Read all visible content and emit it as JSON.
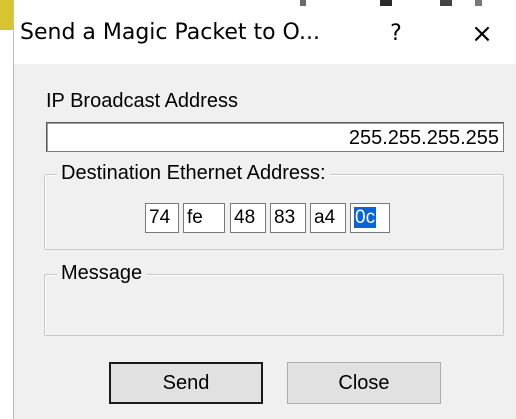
{
  "window": {
    "title": "Send a Magic Packet to O...",
    "help_label": "?",
    "close_label": "×"
  },
  "ip_broadcast": {
    "label": "IP Broadcast Address",
    "value": "255.255.255.255"
  },
  "destination": {
    "legend": "Destination Ethernet Address:",
    "octets": [
      "74",
      "fe",
      "48",
      "83",
      "a4",
      "0c"
    ],
    "selected_octet_index": 5
  },
  "message": {
    "legend": "Message"
  },
  "buttons": {
    "send_label": "Send",
    "close_label": "Close"
  }
}
